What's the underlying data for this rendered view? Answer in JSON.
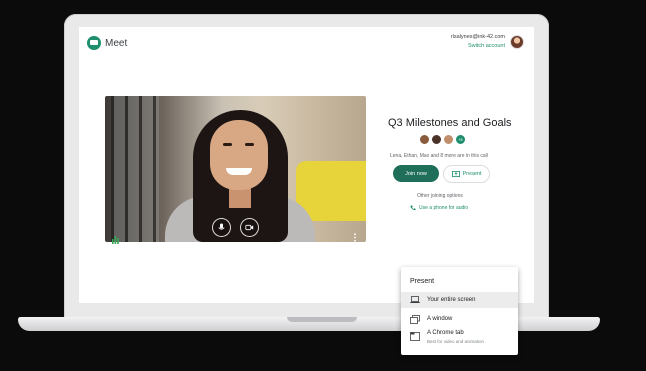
{
  "app": {
    "name": "Meet"
  },
  "account": {
    "email": "rlsalynes@ink-42.com",
    "switch_label": "Switch account"
  },
  "meeting": {
    "title": "Q3 Milestones and Goals",
    "participants_text": "Lena, Ethan, Max and 8 more are in this call",
    "extra_count": "+8",
    "join_label": "Join now",
    "present_label": "Present",
    "other_options_label": "Other joining options",
    "phone_label": "Use a phone for audio"
  },
  "present_menu": {
    "title": "Present",
    "items": [
      {
        "label": "Your entire screen",
        "icon": "laptop-icon",
        "selected": true
      },
      {
        "label": "A window",
        "icon": "window-icon",
        "selected": false
      },
      {
        "label": "A Chrome tab",
        "subtitle": "Best for video and animation",
        "icon": "tab-icon",
        "selected": false
      }
    ]
  },
  "colors": {
    "brand_green": "#1e8e6e",
    "join_button": "#1e6e5a",
    "background": "#0b0b0b"
  }
}
